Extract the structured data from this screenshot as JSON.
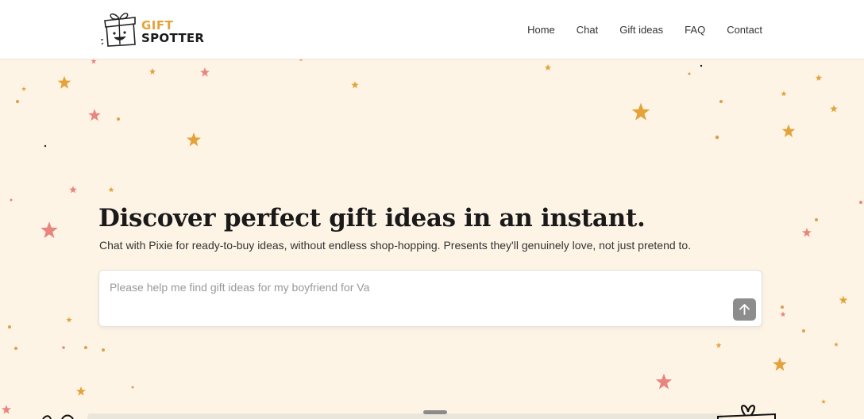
{
  "header": {
    "logo": {
      "line1": "GIFT",
      "line2": "SPOTTER"
    },
    "nav": [
      {
        "label": "Home"
      },
      {
        "label": "Chat"
      },
      {
        "label": "Gift ideas"
      },
      {
        "label": "FAQ"
      },
      {
        "label": "Contact"
      }
    ]
  },
  "hero": {
    "headline": "Discover perfect gift ideas in an instant.",
    "subhead": "Chat with Pixie for ready-to-buy ideas, without endless shop-hopping. Presents they'll genuinely love, not just pretend to.",
    "chat": {
      "placeholder": "Please help me find gift ideas for my boyfriend for Va",
      "send_icon": "arrow-up-icon"
    }
  },
  "colors": {
    "background": "#fdf4e6",
    "accent_gold": "#e4a33a",
    "star_pink": "#e8867d",
    "send_button": "#8d8d8d"
  }
}
